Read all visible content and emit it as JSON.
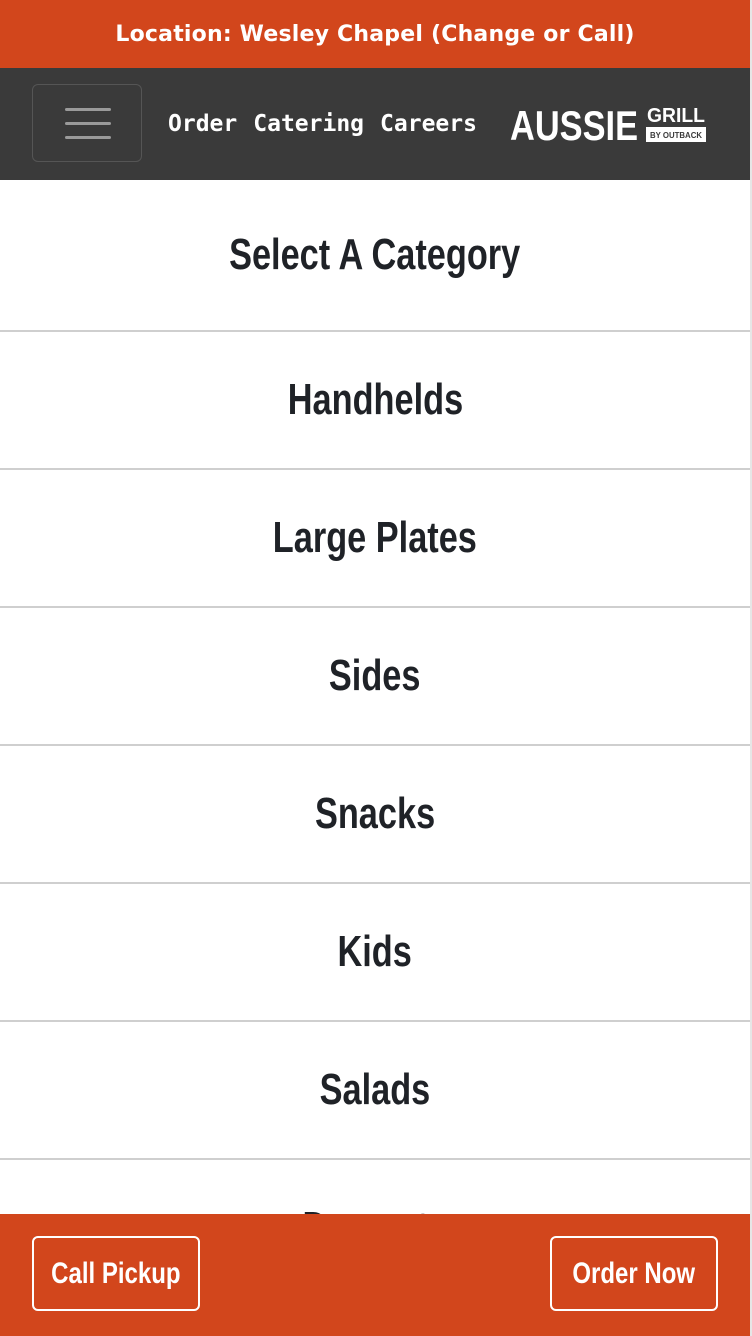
{
  "location_bar": {
    "text": "Location: Wesley Chapel (Change or Call)"
  },
  "navbar": {
    "menu_icon": "hamburger-menu-icon",
    "links": [
      "Order",
      "Catering",
      "Careers"
    ],
    "logo": {
      "main": "AUSSIE",
      "secondary": "GRILL",
      "tagline": "BY OUTBACK"
    }
  },
  "category_list": {
    "heading": "Select A Category",
    "items": [
      "Handhelds",
      "Large Plates",
      "Sides",
      "Snacks",
      "Kids",
      "Salads",
      "Desserts"
    ]
  },
  "bottom_bar": {
    "call_label": "Call Pickup",
    "order_label": "Order Now"
  },
  "colors": {
    "brand_orange": "#d2461c",
    "nav_dark": "#3a3a3a",
    "text_dark": "#1f2227",
    "divider": "#cfcfcf"
  }
}
